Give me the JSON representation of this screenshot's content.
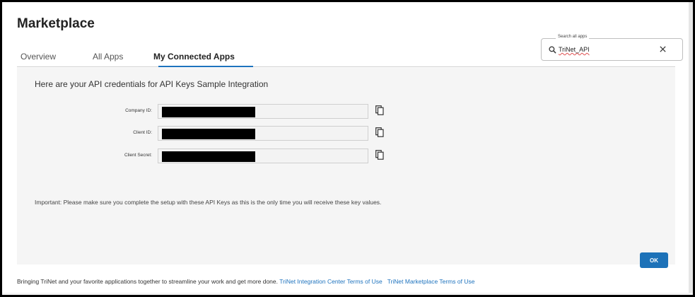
{
  "header": {
    "title": "Marketplace"
  },
  "tabs": [
    {
      "label": "Overview"
    },
    {
      "label": "All Apps"
    },
    {
      "label": "My Connected Apps"
    }
  ],
  "search": {
    "label": "Search all apps",
    "value": "TriNet_API"
  },
  "credentials": {
    "heading": "Here are your API credentials for API Keys Sample Integration",
    "fields": [
      {
        "label": "Company ID:"
      },
      {
        "label": "Client ID:"
      },
      {
        "label": "Client Secret:"
      }
    ],
    "notice": "Important: Please make sure you complete the setup with these API Keys as this is the only time you will receive these key values."
  },
  "actions": {
    "ok_label": "OK"
  },
  "footer": {
    "text": "Bringing TriNet and your favorite applications together to streamline your work and get more done.",
    "link1": "TriNet Integration Center Terms of Use",
    "link2": "TriNet Marketplace Terms of Use"
  },
  "colors": {
    "accent": "#1e73be",
    "button": "#1d72b8"
  },
  "icons": [
    "search-icon",
    "close-icon",
    "copy-icon"
  ]
}
